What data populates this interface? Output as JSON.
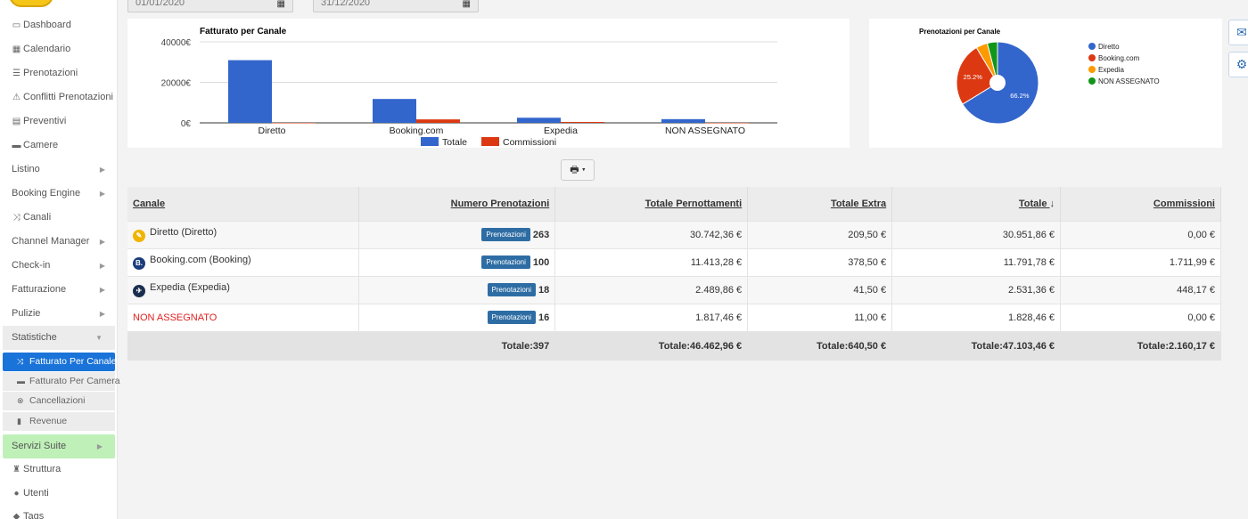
{
  "sidebar": {
    "items": [
      {
        "label": "Dashboard",
        "icon": "dashboard-icon"
      },
      {
        "label": "Calendario",
        "icon": "calendar-icon"
      },
      {
        "label": "Prenotazioni",
        "icon": "list-icon"
      },
      {
        "label": "Conflitti Prenotazioni",
        "icon": "warning-icon"
      },
      {
        "label": "Preventivi",
        "icon": "document-icon"
      },
      {
        "label": "Camere",
        "icon": "bed-icon"
      },
      {
        "label": "Listino",
        "icon": ""
      },
      {
        "label": "Booking Engine",
        "icon": ""
      },
      {
        "label": "Canali",
        "icon": "shuffle-icon"
      },
      {
        "label": "Channel Manager",
        "icon": ""
      },
      {
        "label": "Check-in",
        "icon": ""
      },
      {
        "label": "Fatturazione",
        "icon": ""
      },
      {
        "label": "Pulizie",
        "icon": ""
      },
      {
        "label": "Statistiche",
        "icon": ""
      }
    ],
    "sub_items": [
      {
        "label": "Fatturato Per Canale",
        "icon": "shuffle-icon"
      },
      {
        "label": "Fatturato Per Camera",
        "icon": "bed-icon"
      },
      {
        "label": "Cancellazioni",
        "icon": "cancel-icon"
      },
      {
        "label": "Revenue",
        "icon": "bar-chart-icon"
      }
    ],
    "bottom_items": [
      {
        "label": "Servizi Suite",
        "icon": ""
      },
      {
        "label": "Struttura",
        "icon": "building-icon"
      },
      {
        "label": "Utenti",
        "icon": "user-icon"
      },
      {
        "label": "Tags",
        "icon": "tag-icon"
      }
    ]
  },
  "filters": {
    "date_from": "01/01/2020",
    "date_to": "31/12/2020"
  },
  "chart_data": [
    {
      "type": "bar",
      "title": "Fatturato per Canale",
      "categories": [
        "Diretto",
        "Booking.com",
        "Expedia",
        "NON ASSEGNATO"
      ],
      "series": [
        {
          "name": "Totale",
          "color": "#3366cc",
          "values": [
            30951.86,
            11791.78,
            2531.36,
            1828.46
          ]
        },
        {
          "name": "Commissioni",
          "color": "#dc3912",
          "values": [
            0,
            1711.99,
            448.17,
            0
          ]
        }
      ],
      "yticks": [
        "0€",
        "20000€",
        "40000€"
      ],
      "ylim": [
        0,
        40000
      ],
      "grid": true,
      "legend": "bottom"
    },
    {
      "type": "pie",
      "title": "Prenotazioni per Canale",
      "slices": [
        {
          "name": "Diretto",
          "value": 263,
          "color": "#3366cc",
          "label": "66.2%"
        },
        {
          "name": "Booking.com",
          "value": 100,
          "color": "#dc3912",
          "label": "25.2%"
        },
        {
          "name": "Expedia",
          "value": 18,
          "color": "#ff9900",
          "label": ""
        },
        {
          "name": "NON ASSEGNATO",
          "value": 16,
          "color": "#109618",
          "label": ""
        }
      ],
      "legend": "right"
    }
  ],
  "table": {
    "headers": [
      "Canale",
      "Numero Prenotazioni",
      "Totale Pernottamenti",
      "Totale Extra",
      "Totale",
      "Commissioni"
    ],
    "sort_indicator": "↓",
    "badge_label": "Prenotazioni",
    "rows": [
      {
        "canale": "Diretto (Diretto)",
        "icon": "diretto-icon",
        "icon_color": "#f0b400",
        "icon_glyph": "✎",
        "num": "263",
        "pernottamenti": "30.742,36 €",
        "extra": "209,50 €",
        "totale": "30.951,86 €",
        "commissioni": "0,00 €"
      },
      {
        "canale": "Booking.com (Booking)",
        "icon": "booking-icon",
        "icon_color": "#1a3d7c",
        "icon_glyph": "B.",
        "num": "100",
        "pernottamenti": "11.413,28 €",
        "extra": "378,50 €",
        "totale": "11.791,78 €",
        "commissioni": "1.711,99 €"
      },
      {
        "canale": "Expedia (Expedia)",
        "icon": "expedia-icon",
        "icon_color": "#1a2f4f",
        "icon_glyph": "✈",
        "num": "18",
        "pernottamenti": "2.489,86 €",
        "extra": "41,50 €",
        "totale": "2.531,36 €",
        "commissioni": "448,17 €"
      },
      {
        "canale": "NON ASSEGNATO",
        "icon": "",
        "icon_color": "",
        "icon_glyph": "",
        "num": "16",
        "pernottamenti": "1.817,46 €",
        "extra": "11,00 €",
        "totale": "1.828,46 €",
        "commissioni": "0,00 €"
      }
    ],
    "totals": {
      "num": "Totale:397",
      "pernottamenti": "Totale:46.462,96 €",
      "extra": "Totale:640,50 €",
      "totale": "Totale:47.103,46 €",
      "commissioni": "Totale:2.160,17 €"
    }
  },
  "side_buttons": [
    "mail-icon",
    "settings-icon"
  ],
  "print_button_icon": "print-icon"
}
